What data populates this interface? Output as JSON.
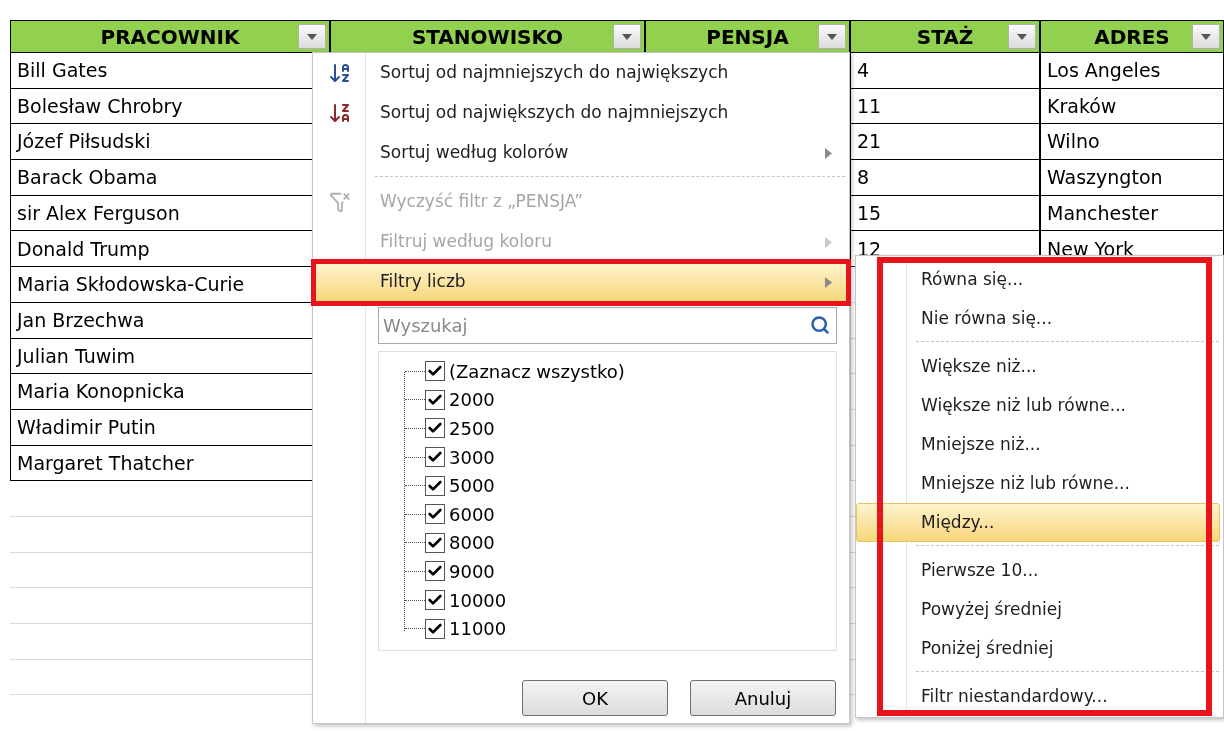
{
  "sheet": {
    "columns": [
      {
        "label": "PRACOWNIK"
      },
      {
        "label": "STANOWISKO"
      },
      {
        "label": "PENSJA"
      },
      {
        "label": "STAŻ"
      },
      {
        "label": "ADRES"
      }
    ],
    "rows": [
      {
        "pracownik": "Bill Gates",
        "staz": "4",
        "adres": "Los Angeles"
      },
      {
        "pracownik": "Bolesław Chrobry",
        "staz": "11",
        "adres": "Kraków"
      },
      {
        "pracownik": "Józef Piłsudski",
        "staz": "21",
        "adres": "Wilno"
      },
      {
        "pracownik": "Barack Obama",
        "staz": "8",
        "adres": "Waszyngton"
      },
      {
        "pracownik": "sir Alex Ferguson",
        "staz": "15",
        "adres": "Manchester"
      },
      {
        "pracownik": "Donald Trump",
        "staz": "12",
        "adres": "New York"
      },
      {
        "pracownik": "Maria Skłodowska-Curie"
      },
      {
        "pracownik": "Jan Brzechwa"
      },
      {
        "pracownik": "Julian Tuwim"
      },
      {
        "pracownik": "Maria Konopnicka"
      },
      {
        "pracownik": "Władimir Putin"
      },
      {
        "pracownik": "Margaret Thatcher"
      }
    ]
  },
  "filter_menu": {
    "items": [
      {
        "kind": "sort-ascending",
        "label": "Sortuj od najmniejszych do największych",
        "disabled": false,
        "submenu": false,
        "selected": false,
        "annotated": false
      },
      {
        "kind": "sort-descending",
        "label": "Sortuj od największych do najmniejszych",
        "disabled": false,
        "submenu": false,
        "selected": false,
        "annotated": false
      },
      {
        "kind": "plain",
        "label": "Sortuj według kolorów",
        "disabled": false,
        "submenu": true,
        "selected": false,
        "annotated": false
      },
      {
        "kind": "separator"
      },
      {
        "kind": "clear-filter",
        "label": "Wyczyść filtr z „PENSJA”",
        "disabled": true,
        "submenu": false,
        "selected": false,
        "annotated": false
      },
      {
        "kind": "plain",
        "label": "Filtruj według koloru",
        "disabled": true,
        "submenu": true,
        "selected": false,
        "annotated": false
      },
      {
        "kind": "plain",
        "label": "Filtry liczb",
        "disabled": false,
        "submenu": true,
        "selected": true,
        "annotated": true
      }
    ],
    "search": {
      "placeholder": "Wyszukaj"
    },
    "values": [
      {
        "label": "(Zaznacz wszystko)",
        "checked": true
      },
      {
        "label": "2000",
        "checked": true
      },
      {
        "label": "2500",
        "checked": true
      },
      {
        "label": "3000",
        "checked": true
      },
      {
        "label": "5000",
        "checked": true
      },
      {
        "label": "6000",
        "checked": true
      },
      {
        "label": "8000",
        "checked": true
      },
      {
        "label": "9000",
        "checked": true
      },
      {
        "label": "10000",
        "checked": true
      },
      {
        "label": "11000",
        "checked": true
      }
    ],
    "buttons": [
      "OK",
      "Anuluj"
    ]
  },
  "number_filters_menu": {
    "annotated": true,
    "items": [
      {
        "kind": "item",
        "label": "Równa się...",
        "selected": false
      },
      {
        "kind": "item",
        "label": "Nie równa się...",
        "selected": false
      },
      {
        "kind": "separator"
      },
      {
        "kind": "item",
        "label": "Większe niż...",
        "selected": false
      },
      {
        "kind": "item",
        "label": "Większe niż lub równe...",
        "selected": false
      },
      {
        "kind": "item",
        "label": "Mniejsze niż...",
        "selected": false
      },
      {
        "kind": "item",
        "label": "Mniejsze niż lub równe...",
        "selected": false
      },
      {
        "kind": "item",
        "label": "Między...",
        "selected": true
      },
      {
        "kind": "separator"
      },
      {
        "kind": "item",
        "label": "Pierwsze 10...",
        "selected": false
      },
      {
        "kind": "item",
        "label": "Powyżej średniej",
        "selected": false
      },
      {
        "kind": "item",
        "label": "Poniżej średniej",
        "selected": false
      },
      {
        "kind": "separator"
      },
      {
        "kind": "item",
        "label": "Filtr niestandardowy...",
        "selected": false
      }
    ]
  }
}
